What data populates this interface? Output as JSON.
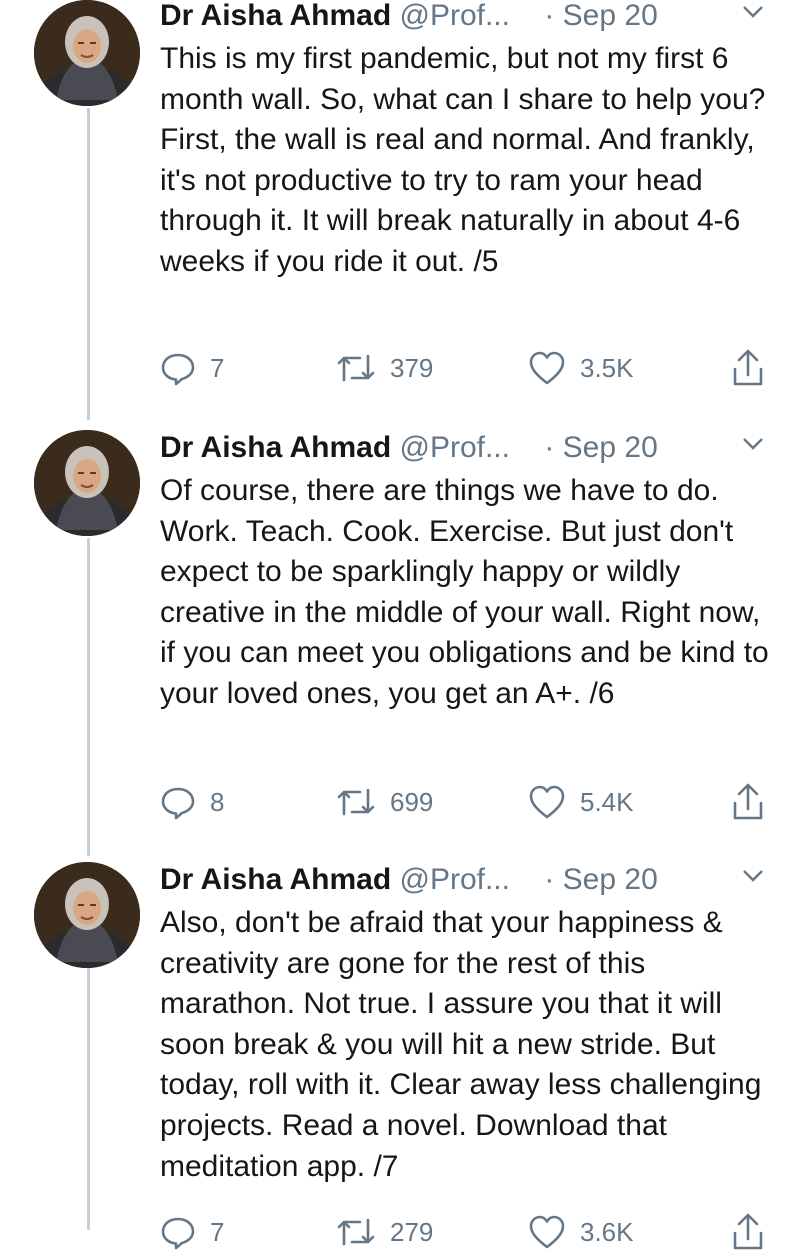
{
  "tweets": [
    {
      "name": "Dr Aisha Ahmad",
      "handle": "@Prof...",
      "separator": "·",
      "date": "Sep 20",
      "text": "This is my first pandemic, but not my first 6 month wall. So, what can I share to help you? First, the wall is real and normal. And frankly, it's not productive to try to ram your head through it. It will break naturally in about 4-6 weeks if you ride it out. /5",
      "replies": "7",
      "retweets": "379",
      "likes": "3.5K"
    },
    {
      "name": "Dr Aisha Ahmad",
      "handle": "@Prof...",
      "separator": "·",
      "date": "Sep 20",
      "text": "Of course, there are things we have to do. Work. Teach. Cook. Exercise. But just don't expect to be sparklingly happy or wildly creative in the middle of your wall. Right now, if you can meet you obligations and be kind to your loved ones, you get an A+. /6",
      "replies": "8",
      "retweets": "699",
      "likes": "5.4K"
    },
    {
      "name": "Dr Aisha Ahmad",
      "handle": "@Prof...",
      "separator": "·",
      "date": "Sep 20",
      "text": "Also, don't be afraid that your happiness & creativity are gone for the rest of this marathon. Not true. I assure you that it will soon break & you will hit a new stride. But today, roll with it. Clear away less challenging projects. Read a novel. Download that meditation app. /7",
      "replies": "7",
      "retweets": "279",
      "likes": "3.6K"
    }
  ],
  "icons": {
    "reply": "reply-icon",
    "retweet": "retweet-icon",
    "like": "like-icon",
    "share": "share-icon",
    "more": "chevron-down-icon"
  },
  "colors": {
    "text": "#14171a",
    "secondary": "#657786",
    "thread_line": "#c4cfd6"
  }
}
